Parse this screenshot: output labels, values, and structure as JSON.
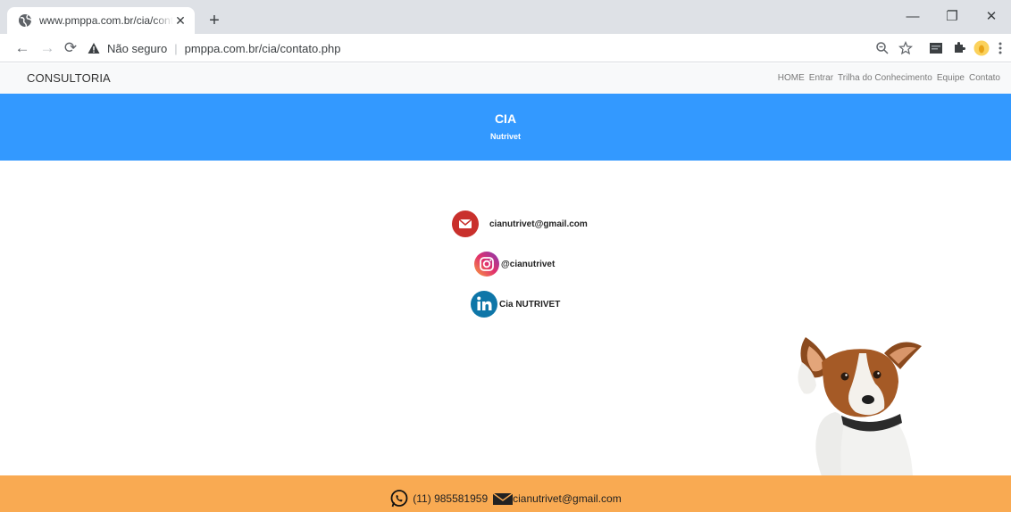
{
  "browser": {
    "tab_title": "www.pmppa.com.br/cia/contato.",
    "tab_close": "✕",
    "new_tab": "+",
    "insecure_label": "Não seguro",
    "separator": "|",
    "url": "pmppa.com.br/cia/contato.php",
    "window_controls": {
      "minimize": "—",
      "restore": "❐",
      "close": "✕"
    }
  },
  "nav": {
    "brand": "CONSULTORIA",
    "links": [
      "HOME",
      "Entrar",
      "Trilha do Conhecimento",
      "Equipe",
      "Contato"
    ]
  },
  "hero": {
    "title": "CIA",
    "subtitle": "Nutrivet",
    "background": "#3399ff"
  },
  "contacts": {
    "email": "cianutrivet@gmail.com",
    "instagram": "@cianutrivet",
    "linkedin": "Cia NUTRIVET"
  },
  "footer": {
    "phone": "(11) 985581959",
    "email": "cianutrivet@gmail.com",
    "background": "#f9aa52"
  },
  "icons": {
    "tab": "globe-icon",
    "warning": "warning-icon",
    "zoom": "zoom-icon",
    "star": "star-icon",
    "extension": "extension-icon",
    "puzzle": "puzzle-icon",
    "profile": "profile-icon",
    "menu": "menu-icon",
    "email": "email-icon",
    "instagram": "instagram-icon",
    "linkedin": "linkedin-icon",
    "whatsapp": "whatsapp-icon"
  }
}
